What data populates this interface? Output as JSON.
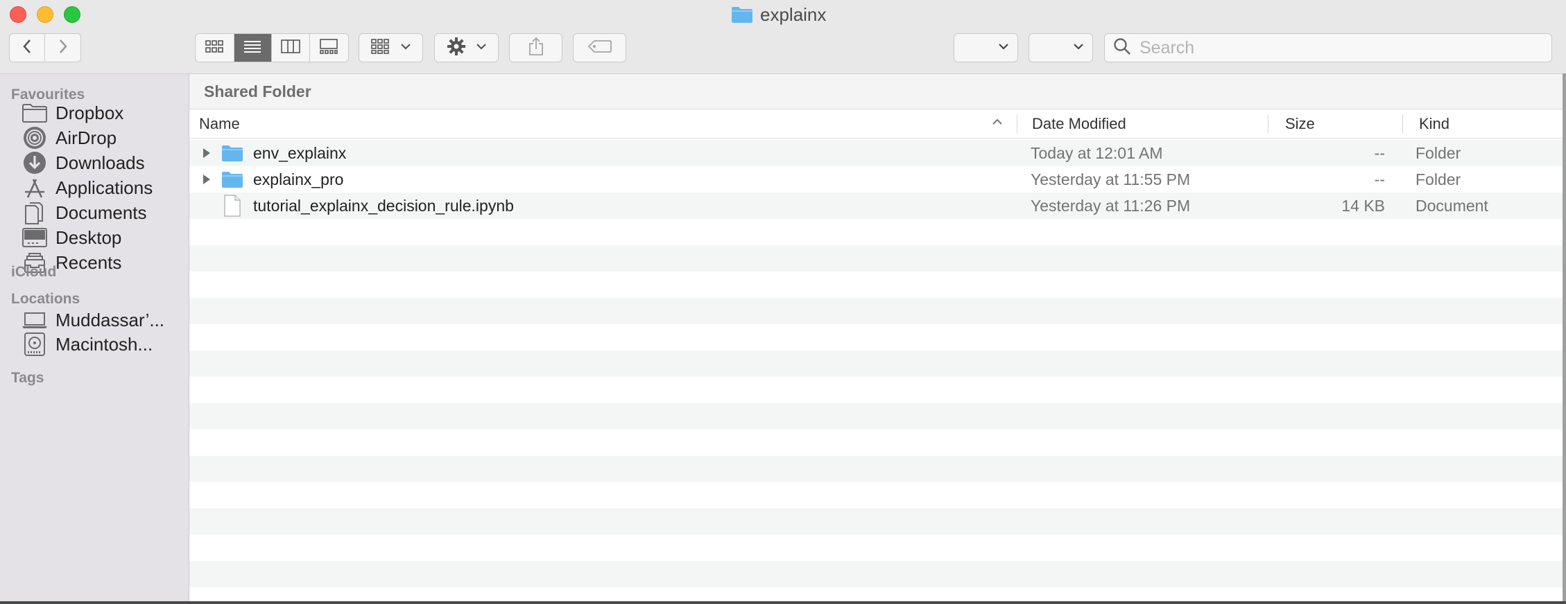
{
  "window": {
    "title": "explainx",
    "colors": {
      "close": "#fe5f57",
      "minimize": "#febc2e",
      "maximize": "#28c840",
      "folder_blue": "#64b6ef"
    }
  },
  "toolbar": {
    "back_icon": "chevron-left-icon",
    "forward_icon": "chevron-right-icon",
    "view_modes": [
      "icon-view",
      "list-view",
      "column-view",
      "gallery-view"
    ],
    "active_view": "list-view",
    "group_icon": "group-icon",
    "action_icon": "gear-icon",
    "share_icon": "share-icon",
    "tag_icon": "tag-icon",
    "search": {
      "placeholder": "Search",
      "value": ""
    }
  },
  "sidebar": {
    "favourites_heading": "Favourites",
    "favourites": [
      {
        "label": "Dropbox",
        "icon": "folder-icon"
      },
      {
        "label": "AirDrop",
        "icon": "airdrop-icon"
      },
      {
        "label": "Downloads",
        "icon": "downloads-icon"
      },
      {
        "label": "Applications",
        "icon": "applications-icon"
      },
      {
        "label": "Documents",
        "icon": "documents-icon"
      },
      {
        "label": "Desktop",
        "icon": "desktop-icon"
      },
      {
        "label": "Recents",
        "icon": "recents-icon"
      }
    ],
    "icloud_heading": "iCloud",
    "locations_heading": "Locations",
    "locations": [
      {
        "label": "Muddassar’...",
        "icon": "laptop-icon"
      },
      {
        "label": "Macintosh...",
        "icon": "hard-drive-icon"
      }
    ],
    "tags_heading": "Tags"
  },
  "main": {
    "path_label": "Shared Folder",
    "columns": {
      "name": "Name",
      "date": "Date Modified",
      "size": "Size",
      "kind": "Kind"
    },
    "sort": {
      "column": "name",
      "direction": "ascending"
    },
    "files": [
      {
        "name": "env_explainx",
        "date": "Today at 12:01 AM",
        "size": "--",
        "kind": "Folder",
        "type": "folder"
      },
      {
        "name": "explainx_pro",
        "date": "Yesterday at 11:55 PM",
        "size": "--",
        "kind": "Folder",
        "type": "folder"
      },
      {
        "name": "tutorial_explainx_decision_rule.ipynb",
        "date": "Yesterday at 11:26 PM",
        "size": "14 KB",
        "kind": "Document",
        "type": "document"
      }
    ]
  }
}
